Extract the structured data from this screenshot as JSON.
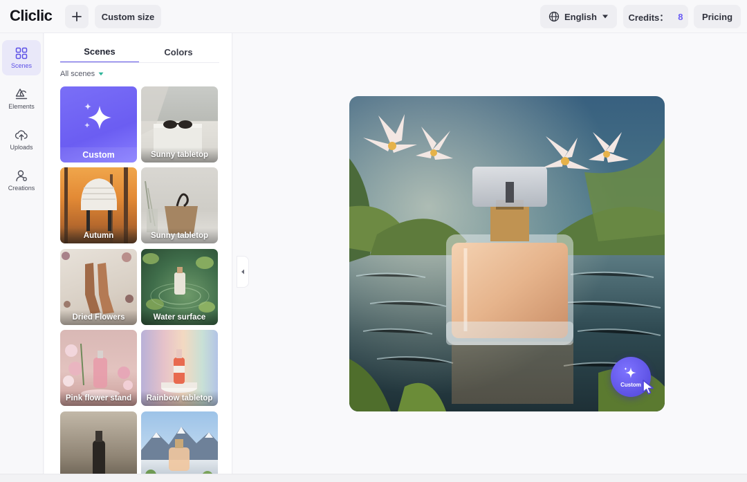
{
  "app": {
    "logo": "Cliclic"
  },
  "topbar": {
    "custom_size_label": "Custom size",
    "language_label": "English",
    "credits_label": "Credits：",
    "credits_value": "8",
    "pricing_label": "Pricing"
  },
  "rail": {
    "items": [
      {
        "label": "Scenes",
        "icon": "scenes-grid-icon",
        "active": true
      },
      {
        "label": "Elements",
        "icon": "shapes-icon",
        "active": false
      },
      {
        "label": "Uploads",
        "icon": "upload-cloud-icon",
        "active": false
      },
      {
        "label": "Creations",
        "icon": "person-icon",
        "active": false
      }
    ]
  },
  "panel": {
    "tabs": [
      {
        "label": "Scenes",
        "active": true
      },
      {
        "label": "Colors",
        "active": false
      }
    ],
    "filter_label": "All scenes",
    "scenes": [
      {
        "label": "Custom"
      },
      {
        "label": "Sunny tabletop"
      },
      {
        "label": "Autumn"
      },
      {
        "label": "Sunny tabletop"
      },
      {
        "label": "Dried Flowers"
      },
      {
        "label": "Water surface"
      },
      {
        "label": "Pink flower stand"
      },
      {
        "label": "Rainbow tabletop"
      },
      {
        "label": ""
      },
      {
        "label": ""
      }
    ]
  },
  "canvas": {
    "fab_label": "Custom"
  },
  "colors": {
    "accent": "#5b4fe6",
    "credits": "#6a5cf5",
    "custom_card": "#7065f5"
  }
}
